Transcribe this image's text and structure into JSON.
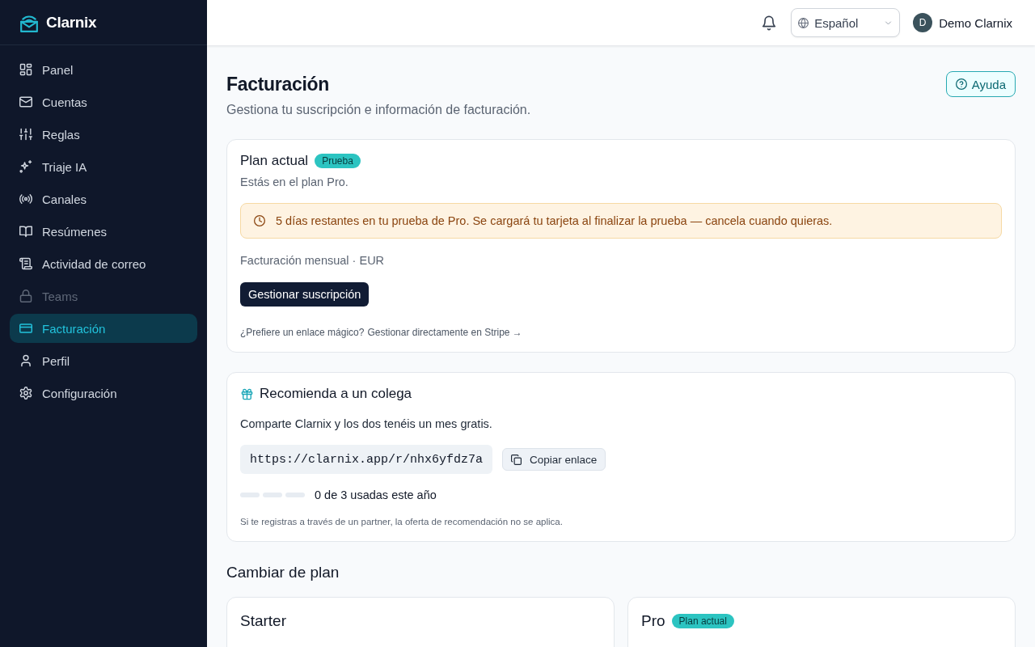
{
  "brand": {
    "name": "Clarnix"
  },
  "sidebar": {
    "items": [
      {
        "label": "Panel",
        "selected": false,
        "disabled": false
      },
      {
        "label": "Cuentas",
        "selected": false,
        "disabled": false
      },
      {
        "label": "Reglas",
        "selected": false,
        "disabled": false
      },
      {
        "label": "Triaje IA",
        "selected": false,
        "disabled": false
      },
      {
        "label": "Canales",
        "selected": false,
        "disabled": false
      },
      {
        "label": "Resúmenes",
        "selected": false,
        "disabled": false
      },
      {
        "label": "Actividad de correo",
        "selected": false,
        "disabled": false
      },
      {
        "label": "Teams",
        "selected": false,
        "disabled": true
      },
      {
        "label": "Facturación",
        "selected": true,
        "disabled": false
      },
      {
        "label": "Perfil",
        "selected": false,
        "disabled": false
      },
      {
        "label": "Configuración",
        "selected": false,
        "disabled": false
      }
    ]
  },
  "topbar": {
    "language": {
      "value": "Español"
    },
    "user": {
      "initial": "D",
      "name": "Demo Clarnix"
    }
  },
  "page": {
    "title": "Facturación",
    "subtitle": "Gestiona tu suscripción e información de facturación.",
    "help_button": "Ayuda"
  },
  "current_plan": {
    "title": "Plan actual",
    "badge": "Prueba",
    "description": "Estás en el plan Pro.",
    "alert": "5 días restantes en tu prueba de Pro. Se cargará tu tarjeta al finalizar la prueba — cancela cuando quieras.",
    "billing": "Facturación mensual · EUR",
    "manage_button": "Gestionar suscripción",
    "magic_prompt": "¿Prefiere un enlace mágico?",
    "magic_link": "Gestionar directamente en Stripe →"
  },
  "referral": {
    "title": "Recomienda a un colega",
    "description": "Comparte Clarnix y los dos tenéis un mes gratis.",
    "link": "https://clarnix.app/r/nhx6yfdz7a",
    "copy_button": "Copiar enlace",
    "usage_segments": [
      {
        "filled": false
      },
      {
        "filled": false
      },
      {
        "filled": false
      }
    ],
    "usage": "0 de 3 usadas este año",
    "note": "Si te registras a través de un partner, la oferta de recomendación no se aplica."
  },
  "change_plan": {
    "title": "Cambiar de plan",
    "plans": [
      {
        "name": "Starter"
      },
      {
        "name": "Pro",
        "badge": "Plan actual"
      }
    ]
  }
}
